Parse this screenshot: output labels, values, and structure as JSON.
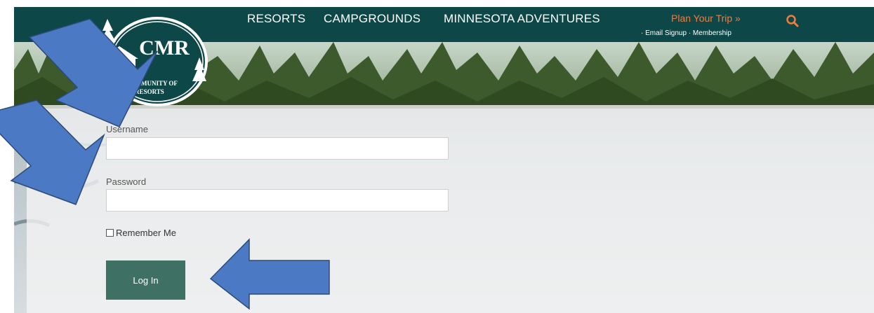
{
  "nav": {
    "items": [
      "RESORTS",
      "CAMPGROUNDS",
      "MINNESOTA ADVENTURES"
    ],
    "plan_trip": "Plan Your Trip »",
    "email_signup": "Email Signup",
    "membership": "Membership",
    "search_icon": "search-icon"
  },
  "logo": {
    "abbr": "CMR",
    "line1": "COMMUNITY OF",
    "line2": "INNESOTA RESORTS"
  },
  "form": {
    "username_label": "Username",
    "username_value": "",
    "password_label": "Password",
    "password_value": "",
    "remember_label": "Remember Me",
    "remember_checked": false,
    "login_button": "Log In"
  },
  "colors": {
    "nav_bg": "#0d4748",
    "plan_trip": "#f47c3c",
    "button_bg": "#3e7064",
    "arrow_fill": "#4b79c4"
  }
}
